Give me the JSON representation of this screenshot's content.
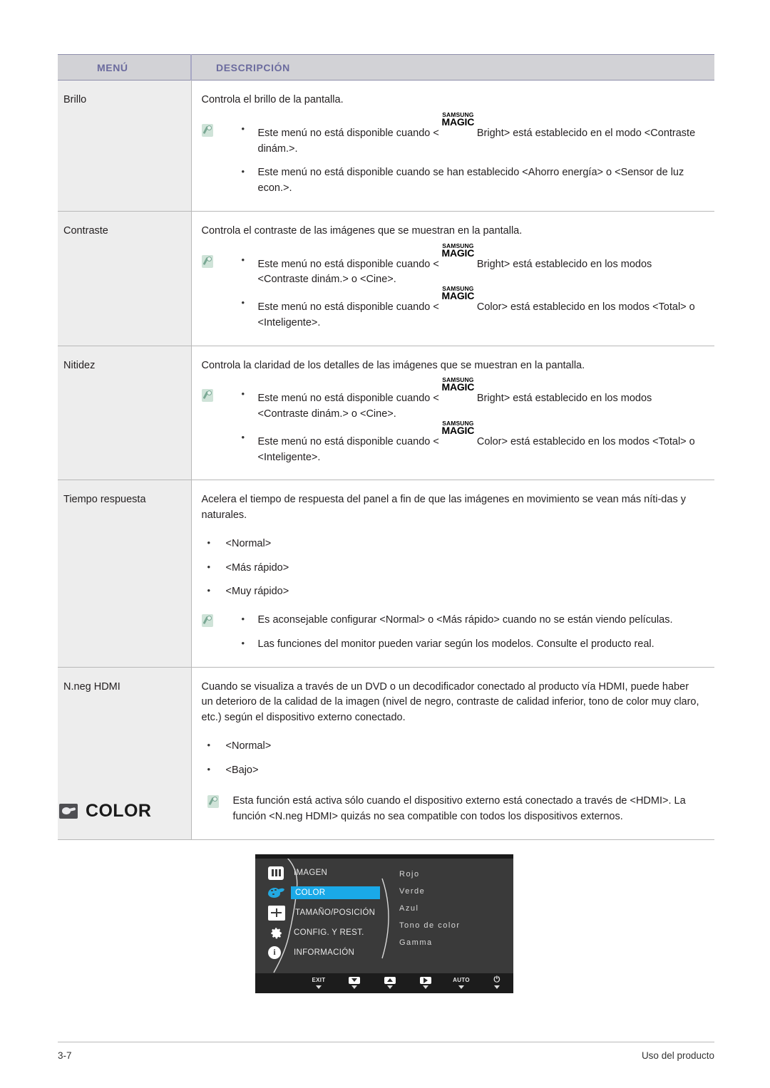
{
  "table": {
    "headers": {
      "menu": "MENÚ",
      "description": "DESCRIPCIÓN"
    },
    "rows": [
      {
        "menu": "Brillo",
        "intro": "Controla el brillo de la pantalla.",
        "note_bullets": [
          {
            "pre": "Este menú no está disponible cuando <",
            "magic": true,
            "post": "Bright> está establecido en el modo <Contraste dinám.>."
          },
          {
            "pre": "Este menú no está disponible cuando se han establecido <Ahorro energía> o <Sensor de luz econ.>.",
            "magic": false,
            "post": ""
          }
        ]
      },
      {
        "menu": "Contraste",
        "intro": "Controla el contraste de las imágenes que se muestran en la pantalla.",
        "note_bullets": [
          {
            "pre": "Este menú no está disponible cuando <",
            "magic": true,
            "post": "Bright> está establecido en los modos <Contraste dinám.> o <Cine>."
          },
          {
            "pre": "Este menú no está disponible cuando <",
            "magic": true,
            "post": "Color> está establecido en los modos <Total> o <Inteligente>."
          }
        ]
      },
      {
        "menu": "Nitidez",
        "intro": "Controla la claridad de los detalles de las imágenes que se muestran en la pantalla.",
        "note_bullets": [
          {
            "pre": "Este menú no está disponible cuando <",
            "magic": true,
            "post": "Bright> está establecido en los modos <Contraste dinám.> o <Cine>."
          },
          {
            "pre": "Este menú no está disponible cuando <",
            "magic": true,
            "post": "Color> está establecido en los modos <Total> o <Inteligente>."
          }
        ]
      },
      {
        "menu": "Tiempo respuesta",
        "intro": "Acelera el tiempo de respuesta del panel a fin de que las imágenes en movimiento se vean más níti-das y naturales.",
        "options": [
          "<Normal>",
          "<Más rápido>",
          "<Muy rápido>"
        ],
        "note_bullets": [
          {
            "pre": "Es aconsejable configurar <Normal> o <Más rápido> cuando no se están viendo películas.",
            "magic": false,
            "post": ""
          },
          {
            "pre": "Las funciones del monitor pueden variar según los modelos. Consulte el producto real.",
            "magic": false,
            "post": ""
          }
        ]
      },
      {
        "menu": "N.neg HDMI",
        "intro": "Cuando se visualiza a través de un DVD o un decodificador conectado al producto vía HDMI, puede haber un deterioro de la calidad de la imagen (nivel de negro, contraste de calidad inferior, tono de color muy claro, etc.) según el dispositivo externo conectado.",
        "options": [
          "<Normal>",
          "<Bajo>"
        ],
        "note_paragraph": "Esta función está activa sólo cuando el dispositivo externo está conectado a través de <HDMI>. La función <N.neg HDMI> quizás no sea compatible con todos los dispositivos externos."
      }
    ]
  },
  "magic_logo": {
    "line1": "SAMSUNG",
    "line2": "MAGIC"
  },
  "section": {
    "title": "COLOR",
    "icon": "display-icon"
  },
  "osd": {
    "menu_items": [
      {
        "label": "IMAGEN",
        "icon": "image-bars-icon",
        "selected": false
      },
      {
        "label": "COLOR",
        "icon": "color-palette-icon",
        "selected": true
      },
      {
        "label": "TAMAÑO/POSICIÓN",
        "icon": "size-position-icon",
        "selected": false
      },
      {
        "label": "CONFIG. Y REST.",
        "icon": "gear-icon",
        "selected": false
      },
      {
        "label": "INFORMACIÓN",
        "icon": "info-icon",
        "selected": false
      }
    ],
    "submenu_items": [
      "Rojo",
      "Verde",
      "Azul",
      "Tono de color",
      "Gamma"
    ],
    "buttons": [
      {
        "label": "EXIT",
        "icon": "exit-text"
      },
      {
        "label": "",
        "icon": "down-arrow-icon"
      },
      {
        "label": "",
        "icon": "up-arrow-icon"
      },
      {
        "label": "",
        "icon": "enter-arrow-icon"
      },
      {
        "label": "AUTO",
        "icon": "auto-text"
      },
      {
        "label": "",
        "icon": "power-icon"
      }
    ],
    "highlight_color": "#1aa9e8",
    "accent_color": "#23a9e1"
  },
  "footer": {
    "page_number": "3-7",
    "chapter": "Uso del producto"
  }
}
